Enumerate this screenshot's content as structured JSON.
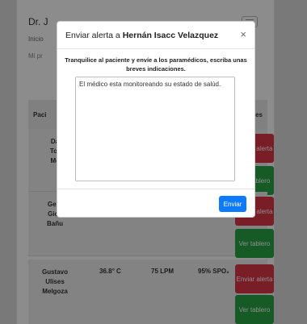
{
  "background": {
    "doctor_name": "Dr. J",
    "nav_home": "Inicio",
    "nav_my": "Mi pr",
    "table": {
      "col_patient": "Paci",
      "col_actions": "iones"
    },
    "rows": [
      {
        "name_lines": [
          "Da",
          "Tor",
          "Mc"
        ],
        "temp": "",
        "bpm": "",
        "spo2": "",
        "alert_label": "Enviar alerta",
        "board_label": "Ver tablero"
      },
      {
        "name_lines": [
          "Gera",
          "Giov",
          "Bañu"
        ],
        "temp": "",
        "bpm": "",
        "spo2": "",
        "alert_label": "Enviar alerta",
        "board_label": "Ver tablero"
      },
      {
        "name_lines": [
          "Gustavo",
          "Ulises",
          "Melgoza"
        ],
        "temp": "36.8° C",
        "bpm": "75 LPM",
        "spo2": "95% SPO₂",
        "alert_label": "Enviar alerta",
        "board_label": "Ver tablero"
      }
    ]
  },
  "modal": {
    "title_prefix": "Enviar alerta a",
    "patient_name": "Hernán Isacc Velazquez",
    "close_symbol": "×",
    "instructions": "Tranquilice al paciente y envíe a los paramédicos, escriba unas breves indicaciones.",
    "message_value": "El médico esta monitoreando su estado de salúd.",
    "send_label": "Enviar"
  },
  "colors": {
    "primary": "#0d7bff",
    "danger": "#dc3545",
    "success": "#28a745"
  }
}
